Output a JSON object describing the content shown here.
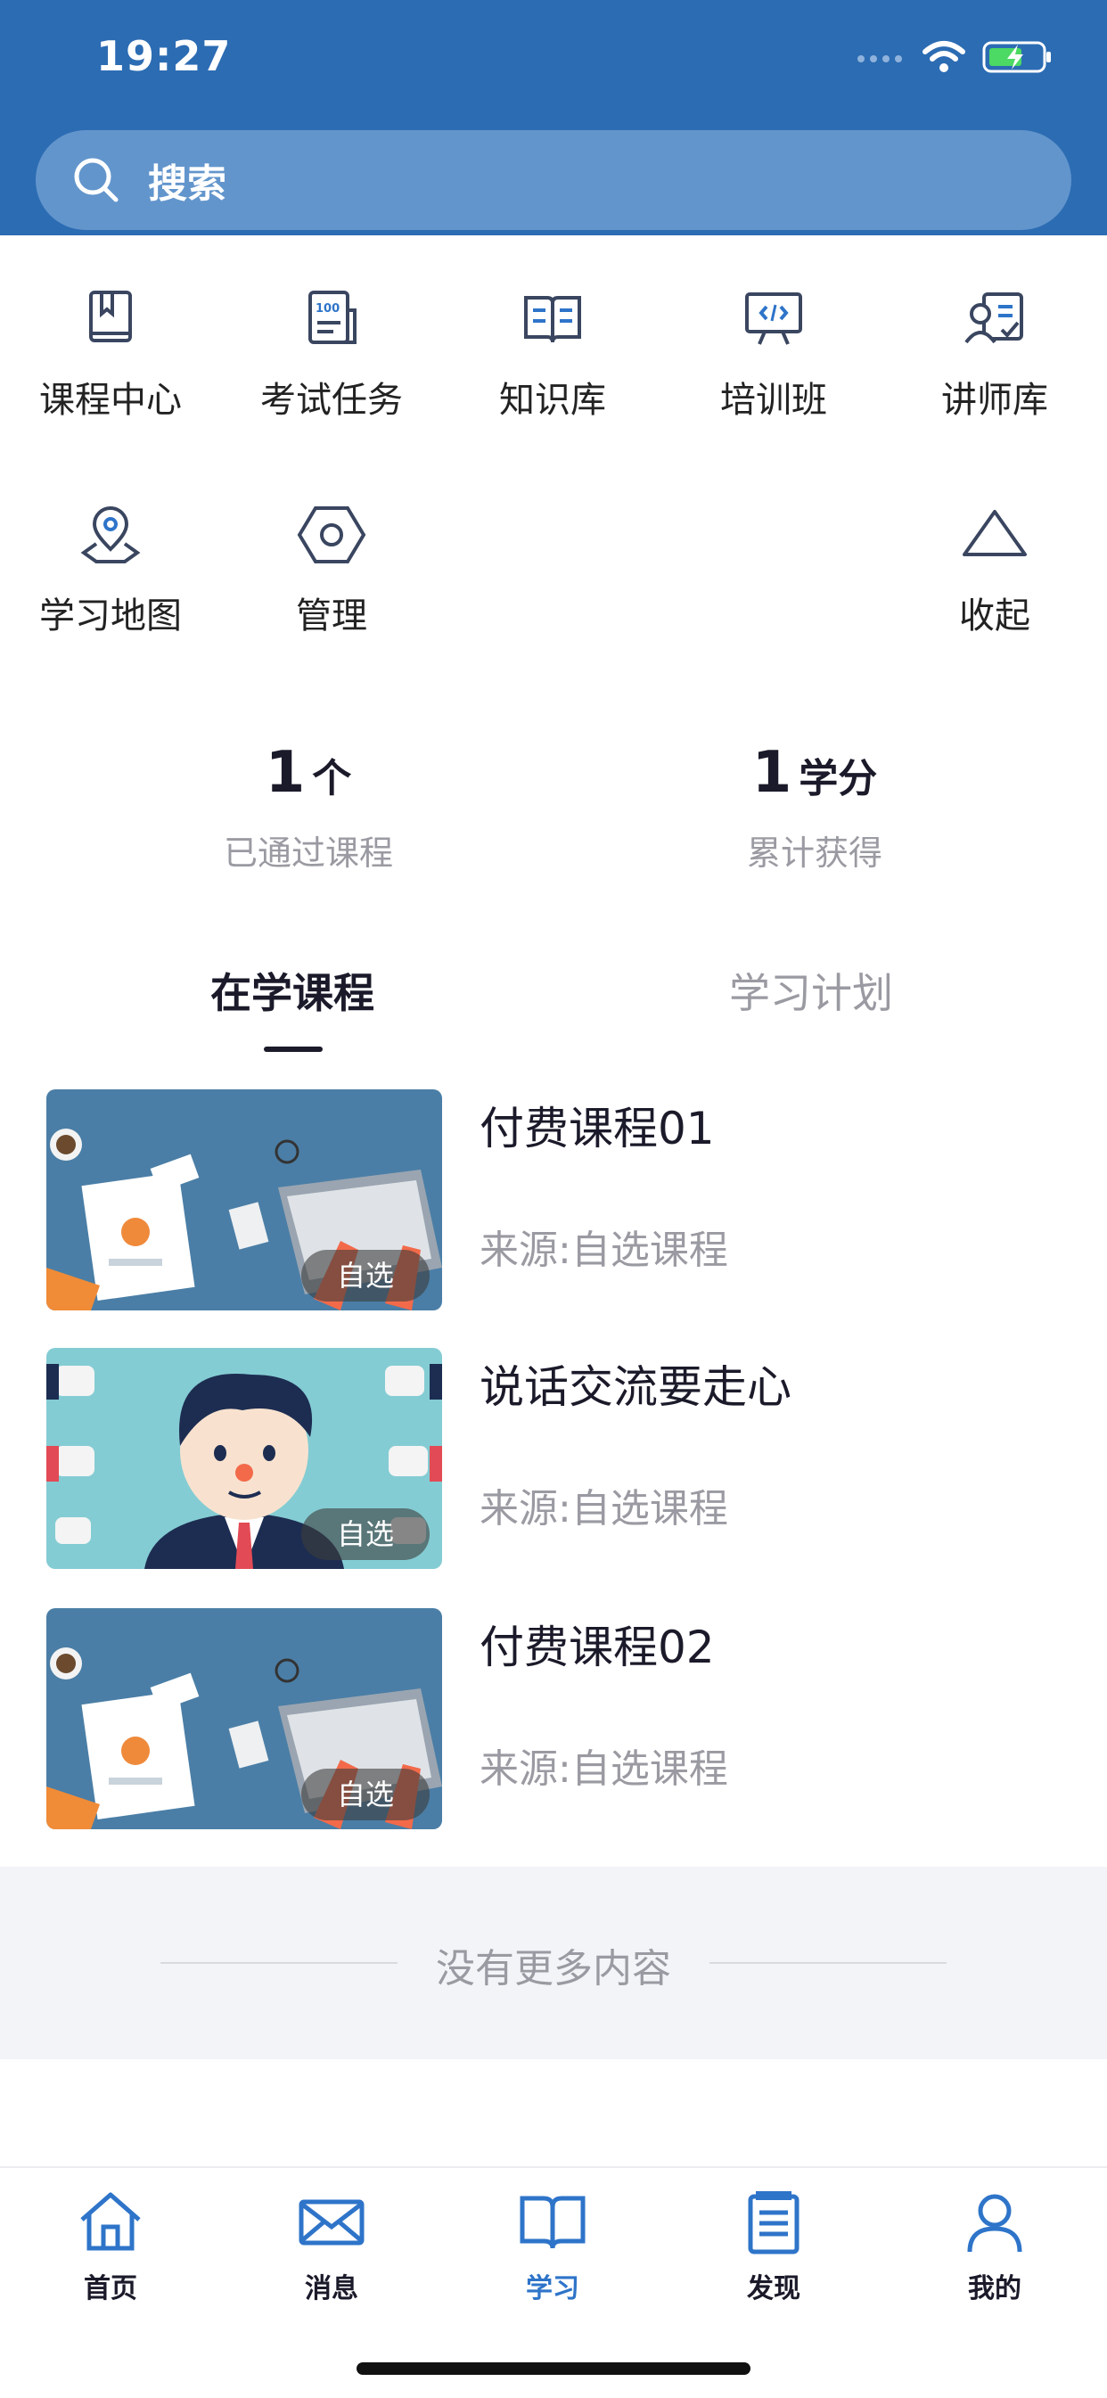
{
  "status": {
    "time": "19:27"
  },
  "search": {
    "placeholder": "搜索"
  },
  "grid": {
    "items": [
      {
        "label": "课程中心",
        "icon": "book-icon"
      },
      {
        "label": "考试任务",
        "icon": "exam-icon"
      },
      {
        "label": "知识库",
        "icon": "open-book-icon"
      },
      {
        "label": "培训班",
        "icon": "presentation-icon"
      },
      {
        "label": "讲师库",
        "icon": "lecturer-icon"
      },
      {
        "label": "学习地图",
        "icon": "map-pin-icon"
      },
      {
        "label": "管理",
        "icon": "hexagon-gear-icon"
      },
      {
        "label": "收起",
        "icon": "triangle-up-icon"
      }
    ]
  },
  "stats": [
    {
      "value": "1",
      "unit": "个",
      "caption": "已通过课程"
    },
    {
      "value": "1",
      "unit": "学分",
      "caption": "累计获得"
    }
  ],
  "tabs": [
    {
      "label": "在学课程",
      "active": true
    },
    {
      "label": "学习计划",
      "active": false
    }
  ],
  "courses": [
    {
      "title": "付费课程01",
      "source": "来源:自选课程",
      "badge": "自选"
    },
    {
      "title": "说话交流要走心",
      "source": "来源:自选课程",
      "badge": "自选"
    },
    {
      "title": "付费课程02",
      "source": "来源:自选课程",
      "badge": "自选"
    }
  ],
  "footer": {
    "no_more": "没有更多内容"
  },
  "tabbar": {
    "items": [
      {
        "label": "首页",
        "icon": "home-icon"
      },
      {
        "label": "消息",
        "icon": "mail-icon"
      },
      {
        "label": "学习",
        "icon": "study-book-icon",
        "active": true
      },
      {
        "label": "发现",
        "icon": "document-icon"
      },
      {
        "label": "我的",
        "icon": "user-icon"
      }
    ]
  },
  "colors": {
    "header": "#2c6cb3",
    "accent": "#2e74c9",
    "muted": "#9a9aa2"
  }
}
